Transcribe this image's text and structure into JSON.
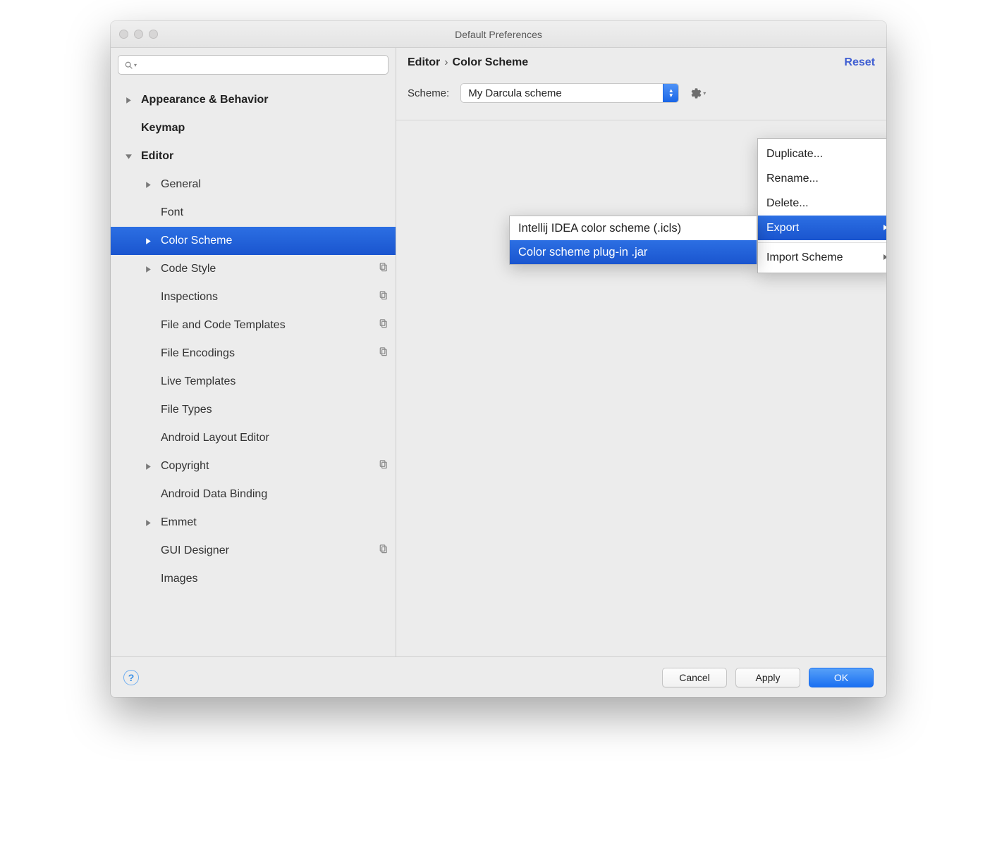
{
  "window_title": "Default Preferences",
  "search_placeholder": "",
  "sidebar": [
    {
      "label": "Appearance & Behavior",
      "indent": 0,
      "bold": true,
      "disclosure": "right",
      "copy": false,
      "selected": false
    },
    {
      "label": "Keymap",
      "indent": 0,
      "bold": true,
      "disclosure": "none",
      "copy": false,
      "selected": false
    },
    {
      "label": "Editor",
      "indent": 0,
      "bold": true,
      "disclosure": "down",
      "copy": false,
      "selected": false
    },
    {
      "label": "General",
      "indent": 1,
      "bold": false,
      "disclosure": "right",
      "copy": false,
      "selected": false
    },
    {
      "label": "Font",
      "indent": 1,
      "bold": false,
      "disclosure": "none",
      "copy": false,
      "selected": false
    },
    {
      "label": "Color Scheme",
      "indent": 1,
      "bold": false,
      "disclosure": "right",
      "copy": false,
      "selected": true
    },
    {
      "label": "Code Style",
      "indent": 1,
      "bold": false,
      "disclosure": "right",
      "copy": true,
      "selected": false
    },
    {
      "label": "Inspections",
      "indent": 1,
      "bold": false,
      "disclosure": "none",
      "copy": true,
      "selected": false
    },
    {
      "label": "File and Code Templates",
      "indent": 1,
      "bold": false,
      "disclosure": "none",
      "copy": true,
      "selected": false
    },
    {
      "label": "File Encodings",
      "indent": 1,
      "bold": false,
      "disclosure": "none",
      "copy": true,
      "selected": false
    },
    {
      "label": "Live Templates",
      "indent": 1,
      "bold": false,
      "disclosure": "none",
      "copy": false,
      "selected": false
    },
    {
      "label": "File Types",
      "indent": 1,
      "bold": false,
      "disclosure": "none",
      "copy": false,
      "selected": false
    },
    {
      "label": "Android Layout Editor",
      "indent": 1,
      "bold": false,
      "disclosure": "none",
      "copy": false,
      "selected": false
    },
    {
      "label": "Copyright",
      "indent": 1,
      "bold": false,
      "disclosure": "right",
      "copy": true,
      "selected": false
    },
    {
      "label": "Android Data Binding",
      "indent": 1,
      "bold": false,
      "disclosure": "none",
      "copy": false,
      "selected": false
    },
    {
      "label": "Emmet",
      "indent": 1,
      "bold": false,
      "disclosure": "right",
      "copy": false,
      "selected": false
    },
    {
      "label": "GUI Designer",
      "indent": 1,
      "bold": false,
      "disclosure": "none",
      "copy": true,
      "selected": false
    },
    {
      "label": "Images",
      "indent": 1,
      "bold": false,
      "disclosure": "none",
      "copy": false,
      "selected": false
    }
  ],
  "breadcrumb": {
    "a": "Editor",
    "sep": "›",
    "b": "Color Scheme"
  },
  "reset_label": "Reset",
  "scheme": {
    "label": "Scheme:",
    "value": "My Darcula scheme"
  },
  "gear_menu": [
    {
      "label": "Duplicate...",
      "highlighted": false,
      "submenu": false,
      "separator_after": false
    },
    {
      "label": "Rename...",
      "highlighted": false,
      "submenu": false,
      "separator_after": false
    },
    {
      "label": "Delete...",
      "highlighted": false,
      "submenu": false,
      "separator_after": false
    },
    {
      "label": "Export",
      "highlighted": true,
      "submenu": true,
      "separator_after": true
    },
    {
      "label": "Import Scheme",
      "highlighted": false,
      "submenu": true,
      "separator_after": false
    }
  ],
  "export_submenu": [
    {
      "label": "Intellij IDEA color scheme (.icls)",
      "highlighted": false
    },
    {
      "label": "Color scheme plug-in .jar",
      "highlighted": true
    }
  ],
  "footer": {
    "help": "?",
    "cancel": "Cancel",
    "apply": "Apply",
    "ok": "OK"
  }
}
